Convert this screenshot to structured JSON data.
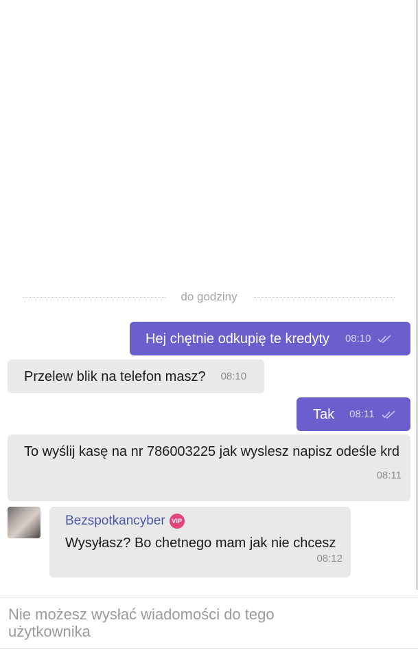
{
  "divider": {
    "label": "do godziny"
  },
  "messages": [
    {
      "direction": "out",
      "text": "Hej chętnie odkupię te kredyty",
      "time": "08:10",
      "read_icon": "double-check-icon"
    },
    {
      "direction": "in",
      "text": "Przelew blik na telefon masz?",
      "time": "08:10"
    },
    {
      "direction": "out",
      "text": "Tak",
      "time": "08:11",
      "read_icon": "double-check-icon"
    },
    {
      "direction": "in",
      "text": "To wyślij kasę na nr 786003225 jak wyslesz napisz odeśle krd",
      "time": "08:11"
    },
    {
      "direction": "in",
      "sender": "Bezspotkancyber",
      "badge": "VIP",
      "text": "Wysyłasz? Bo chetnego mam jak nie chcesz",
      "time": "08:12"
    }
  ],
  "composer": {
    "disabled_text": "Nie możesz wysłać wiadomości do tego użytkownika"
  },
  "colors": {
    "outgoing_bubble": "#6b5fce",
    "incoming_bubble": "#e9e9e9",
    "sender_name": "#4c56a6",
    "vip_badge": "#e0457b"
  }
}
